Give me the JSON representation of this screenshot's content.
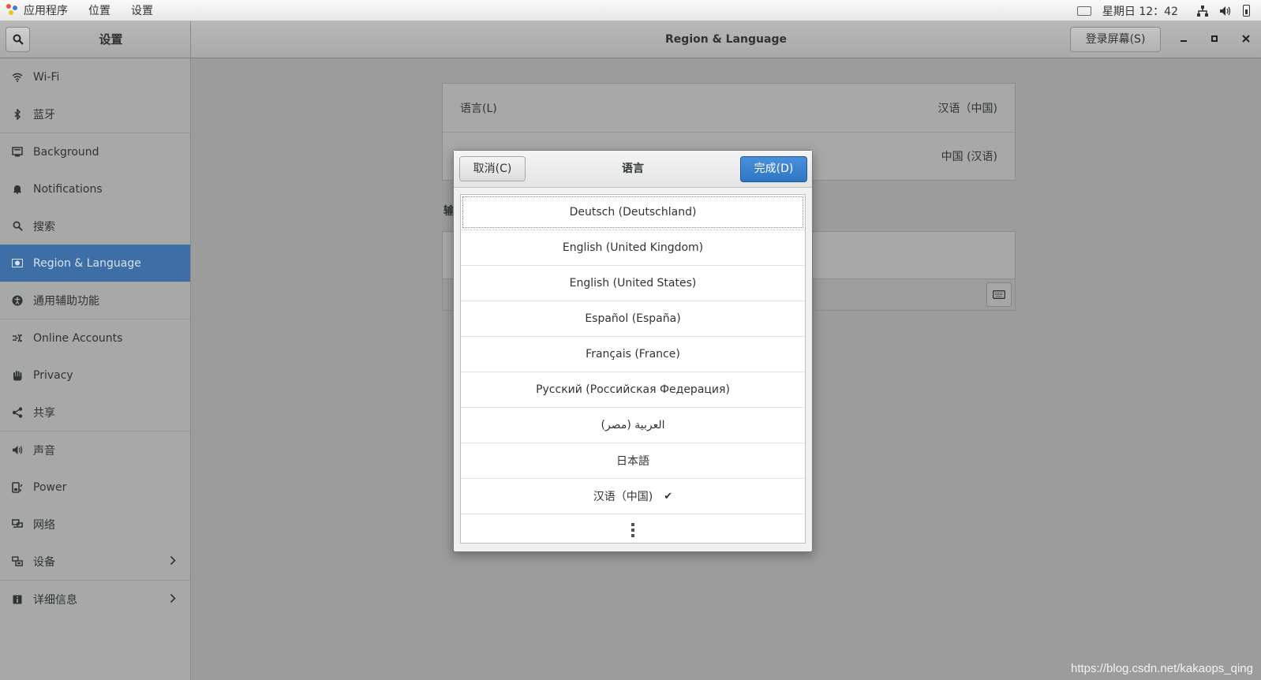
{
  "topbar": {
    "menus": [
      "应用程序",
      "位置",
      "设置"
    ],
    "clock": "星期日 12：42",
    "icons": [
      "keyboard-icon",
      "network-icon",
      "volume-icon",
      "battery-icon"
    ]
  },
  "window": {
    "sidebar_title": "设置",
    "title": "Region & Language",
    "login_screen_button": "登录屏幕(S)"
  },
  "sidebar": {
    "items": [
      {
        "label": "Wi-Fi",
        "icon": "wifi-icon"
      },
      {
        "label": "蓝牙",
        "icon": "bluetooth-icon"
      },
      {
        "label": "Background",
        "icon": "background-icon"
      },
      {
        "label": "Notifications",
        "icon": "bell-icon"
      },
      {
        "label": "搜索",
        "icon": "search-icon"
      },
      {
        "label": "Region & Language",
        "icon": "region-icon",
        "selected": true
      },
      {
        "label": "通用辅助功能",
        "icon": "accessibility-icon"
      },
      {
        "label": "Online Accounts",
        "icon": "online-accounts-icon"
      },
      {
        "label": "Privacy",
        "icon": "hand-icon"
      },
      {
        "label": "共享",
        "icon": "share-icon"
      },
      {
        "label": "声音",
        "icon": "speaker-icon"
      },
      {
        "label": "Power",
        "icon": "power-icon"
      },
      {
        "label": "网络",
        "icon": "network-icon"
      },
      {
        "label": "设备",
        "icon": "devices-icon"
      },
      {
        "label": "详细信息",
        "icon": "info-icon"
      }
    ]
  },
  "content": {
    "language_label": "语言(L)",
    "language_value": "汉语（中国)",
    "formats_value": "中国 (汉语)",
    "input_sources_label": "输"
  },
  "dialog": {
    "title": "语言",
    "cancel": "取消(C)",
    "done": "完成(D)",
    "languages": [
      "Deutsch (Deutschland)",
      "English (United Kingdom)",
      "English (United States)",
      "Español (España)",
      "Français (France)",
      "Русский (Российская Федерация)",
      "العربية (مصر)",
      "日本語",
      "汉语（中国)"
    ],
    "selected_check": "✔"
  },
  "watermark": "https://blog.csdn.net/kakaops_qing",
  "colors": {
    "accent": "#3d6ea6",
    "done_button": "#2f76c4"
  }
}
